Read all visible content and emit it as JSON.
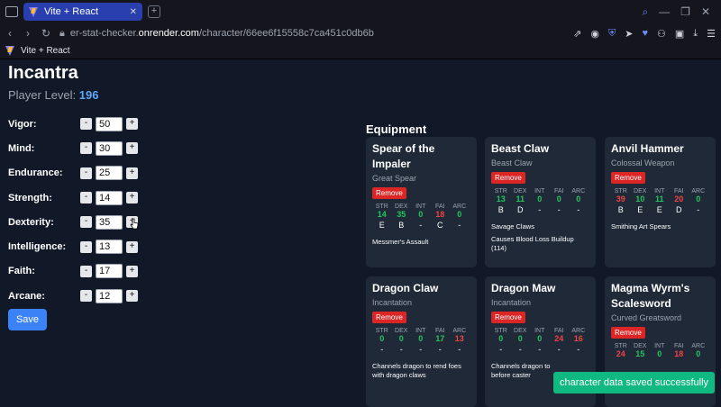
{
  "browser": {
    "tab_title": "Vite + React",
    "url_prefix": "er-stat-checker.",
    "url_host": "onrender.com",
    "url_path": "/character/66ee6f15558c7ca451c0db6b",
    "bookmark": "Vite + React"
  },
  "character": {
    "name": "Incantra",
    "level_label": "Player Level:",
    "level": "196"
  },
  "stats": [
    {
      "label": "Vigor:",
      "value": "50"
    },
    {
      "label": "Mind:",
      "value": "30"
    },
    {
      "label": "Endurance:",
      "value": "25"
    },
    {
      "label": "Strength:",
      "value": "14"
    },
    {
      "label": "Dexterity:",
      "value": "35"
    },
    {
      "label": "Intelligence:",
      "value": "13"
    },
    {
      "label": "Faith:",
      "value": "17"
    },
    {
      "label": "Arcane:",
      "value": "12"
    }
  ],
  "controls": {
    "minus": "-",
    "plus": "+",
    "save": "Save"
  },
  "equipment": {
    "title": "Equipment",
    "remove_label": "Remove",
    "headers": [
      "STR",
      "DEX",
      "INT",
      "FAI",
      "ARC"
    ],
    "items": [
      {
        "name": "Spear of the Impaler",
        "type": "Great Spear",
        "reqs": [
          "14",
          "35",
          "0",
          "18",
          "0"
        ],
        "req_colors": [
          "#22c55e",
          "#22c55e",
          "#22c55e",
          "#ef4444",
          "#22c55e"
        ],
        "grades": [
          "E",
          "B",
          "-",
          "C",
          "-"
        ],
        "skill": "Messmer's Assault",
        "passive": ""
      },
      {
        "name": "Beast Claw",
        "type": "Beast Claw",
        "reqs": [
          "13",
          "11",
          "0",
          "0",
          "0"
        ],
        "req_colors": [
          "#22c55e",
          "#22c55e",
          "#22c55e",
          "#22c55e",
          "#22c55e"
        ],
        "grades": [
          "B",
          "D",
          "-",
          "-",
          "-"
        ],
        "skill": "Savage Claws",
        "passive": "Causes Blood Loss Buildup (114)"
      },
      {
        "name": "Anvil Hammer",
        "type": "Colossal Weapon",
        "reqs": [
          "39",
          "10",
          "11",
          "20",
          "0"
        ],
        "req_colors": [
          "#ef4444",
          "#22c55e",
          "#22c55e",
          "#ef4444",
          "#22c55e"
        ],
        "grades": [
          "B",
          "E",
          "E",
          "D",
          "-"
        ],
        "skill": "Smithing Art Spears",
        "passive": ""
      },
      {
        "name": "Dragon Claw",
        "type": "Incantation",
        "reqs": [
          "0",
          "0",
          "0",
          "17",
          "13"
        ],
        "req_colors": [
          "#22c55e",
          "#22c55e",
          "#22c55e",
          "#22c55e",
          "#ef4444"
        ],
        "grades": [
          "-",
          "-",
          "-",
          "-",
          "-"
        ],
        "skill": "Channels dragon to rend foes with dragon claws",
        "passive": ""
      },
      {
        "name": "Dragon Maw",
        "type": "Incantation",
        "reqs": [
          "0",
          "0",
          "0",
          "24",
          "16"
        ],
        "req_colors": [
          "#22c55e",
          "#22c55e",
          "#22c55e",
          "#ef4444",
          "#ef4444"
        ],
        "grades": [
          "-",
          "-",
          "-",
          "-",
          "-"
        ],
        "skill": "Channels dragon to",
        "skill_tail": "before caster",
        "passive": ""
      },
      {
        "name": "Magma Wyrm's Scalesword",
        "type": "Curved Greatsword",
        "reqs": [
          "24",
          "15",
          "0",
          "18",
          "0"
        ],
        "req_colors": [
          "#ef4444",
          "#22c55e",
          "#22c55e",
          "#ef4444",
          "#22c55e"
        ],
        "grades": [
          "",
          "",
          "",
          "",
          ""
        ],
        "skill": "",
        "passive": ""
      }
    ]
  },
  "toast": "character data saved successfully"
}
